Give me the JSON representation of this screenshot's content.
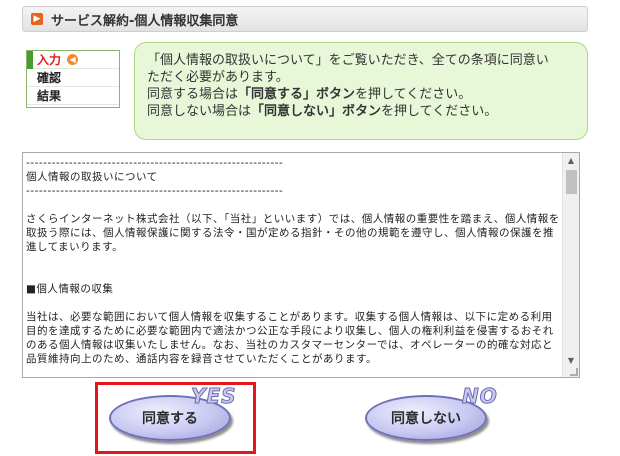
{
  "header": {
    "icon": "square-arrow-icon",
    "title": "サービス解約-個人情報収集同意"
  },
  "steps": [
    {
      "label": "入力",
      "active": true
    },
    {
      "label": "確認",
      "active": false
    },
    {
      "label": "結果",
      "active": false
    }
  ],
  "info": {
    "line1": "「個人情報の取扱いについて」をご覧いただき、全ての条項に同意い",
    "line2": "ただく必要があります。",
    "line3_pre": "同意する場合は",
    "line3_bold": "「同意する」ボタン",
    "line3_post": "を押してください。",
    "line4_pre": "同意しない場合は",
    "line4_bold": "「同意しない」ボタン",
    "line4_post": "を押してください。"
  },
  "terms": {
    "text": "------------------------------------------------------------\n個人情報の取扱いについて\n------------------------------------------------------------\n\nさくらインターネット株式会社（以下、「当社」といいます）では、個人情報の重要性を踏まえ、個人情報を取扱う際には、個人情報保護に関する法令・国が定める指針・その他の規範を遵守し、個人情報の保護を推進してまいります。\n\n\n■個人情報の収集\n\n当社は、必要な範囲において個人情報を収集することがあります。収集する個人情報は、以下に定める利用目的を達成するために必要な範囲内で適法かつ公正な手段により収集し、個人の権利利益を侵害するおそれのある個人情報は収集いたしません。なお、当社のカスタマーセンターでは、オペレーターの的確な対応と品質維持向上のため、通話内容を録音させていただくことがあります。"
  },
  "buttons": {
    "agree_label": "同意する",
    "agree_badge": "YES",
    "disagree_label": "同意しない",
    "disagree_badge": "NO"
  }
}
